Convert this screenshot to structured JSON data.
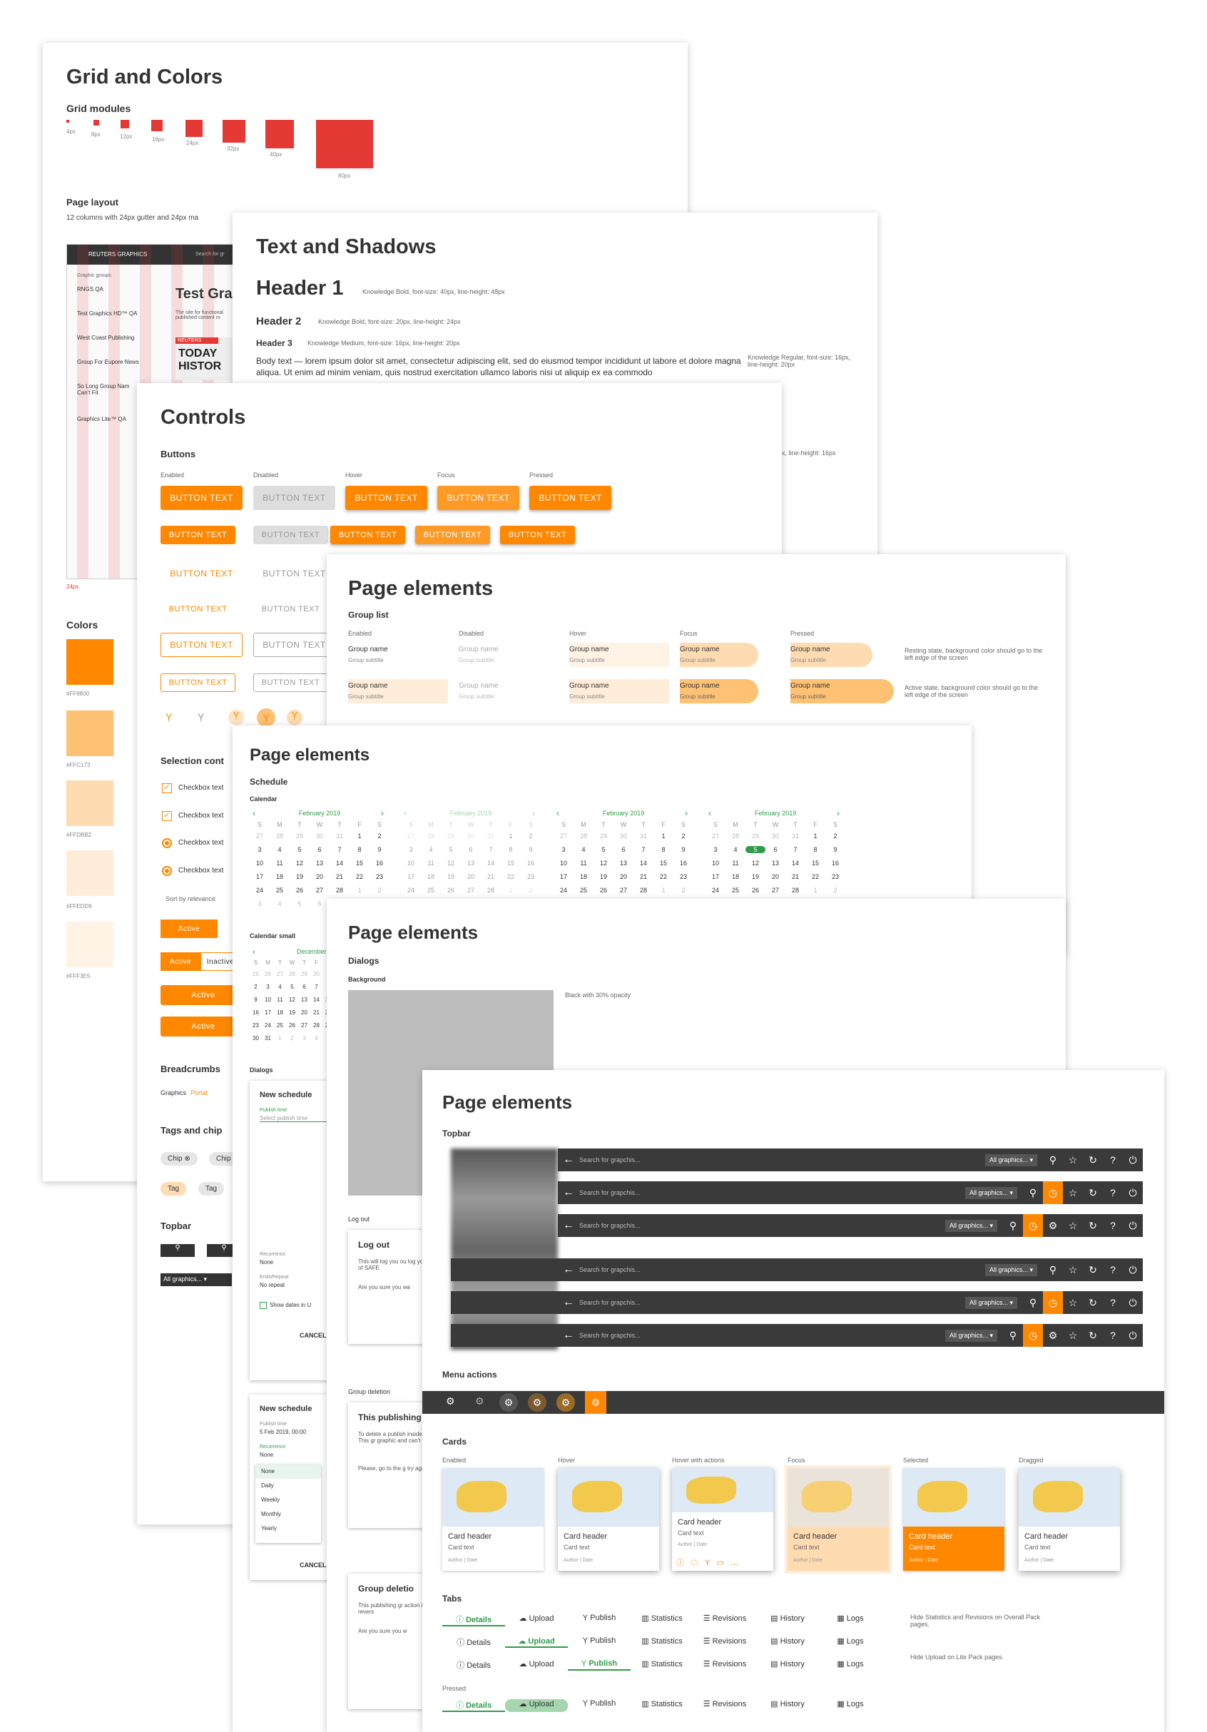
{
  "grid": {
    "title": "Grid and Colors",
    "modules_title": "Grid modules",
    "modules": [
      "4px",
      "8px",
      "12px",
      "16px",
      "24px",
      "32px",
      "40px",
      "80px"
    ],
    "layout_title": "Page layout",
    "layout_desc": "12 columns with 24px gutter and 24px ma",
    "gutter": "24px",
    "colors_title": "Colors",
    "colors": [
      {
        "hex": "#FF8800",
        "label": "#FF8800"
      },
      {
        "hex": "#FFC173",
        "label": "#FFC173"
      },
      {
        "hex": "#FFDBB2",
        "label": "#FFDBB2"
      },
      {
        "hex": "#FFEDD9",
        "label": "#FFEDD9"
      },
      {
        "hex": "#FFF3E5",
        "label": "#FFF3E5"
      }
    ],
    "preview": {
      "brand": "REUTERS GRAPHICS",
      "search": "Search for gr",
      "side_title": "Graphic groups",
      "crumb": "Graphics Portal",
      "heading": "Test Gra",
      "desc": "The site for functional published content m",
      "groups": [
        {
          "name": "RNGS QA",
          "sub": "Group subtitle"
        },
        {
          "name": "Test Graphics HD™ QA",
          "sub": "Group subtitle"
        },
        {
          "name": "West Coast Publishing",
          "sub": "Group subtitle"
        },
        {
          "name": "Group For Eupore News",
          "sub": "Group subtitle"
        },
        {
          "name": "So Long Group Nam Can't Fit",
          "sub": "Group subtitle"
        },
        {
          "name": "Graphics Lite™ QA",
          "sub": "Group subtitle"
        }
      ],
      "news1": "TODAY",
      "news2": "HISTOR",
      "news_brand": "REUTERS"
    }
  },
  "text": {
    "title": "Text and Shadows",
    "h1": "Header 1",
    "h1_note": "Knowledge Bold, font-size: 40px, line-height: 48px",
    "h2": "Header 2",
    "h2_note": "Knowledge Bold, font-size: 20px, line-height: 24px",
    "h3": "Header 3",
    "h3_note": "Knowledge Medium, font-size: 16px, line-height: 20px",
    "body": "Body text — lorem ipsum dolor sit amet, consectetur adipiscing elit, sed do eiusmod tempor incididunt ut labore et dolore magna aliqua. Ut enim ad minim veniam, quis nostrud exercitation ullamco laboris nisi ut aliquip ex ea commodo",
    "body_note": "Knowledge Regular, font-size: 16px, line-height: 20px",
    "note2": "px, line-height: 16px"
  },
  "controls": {
    "title": "Controls",
    "buttons_title": "Buttons",
    "states": [
      "Enabled",
      "Disabled",
      "Hover",
      "Focus",
      "Pressed"
    ],
    "btn": "BUTTON TEXT",
    "selection_title": "Selection cont",
    "checkbox": "Checkbox text",
    "sort": "Sort by relevance",
    "active": "Active",
    "inactive": "Inactive",
    "breadcrumbs_title": "Breadcrumbs",
    "crumb_a": "Graphics",
    "crumb_b": "Portal",
    "tags_title": "Tags and chip",
    "chip": "Chip",
    "tag": "Tag",
    "topbar_title": "Topbar",
    "all_graphics": "All graphics..."
  },
  "group_list": {
    "title": "Page elements",
    "sub": "Group list",
    "states": [
      "Enabled",
      "Disabled",
      "Hover",
      "Focus",
      "Pressed"
    ],
    "name": "Group name",
    "subtitle": "Group subtitle",
    "note1": "Resting state, background color should go to the left edge of the screen",
    "note2": "Active state, background color should go to the left edge of the screen"
  },
  "schedule": {
    "title": "Page elements",
    "sub": "Schedule",
    "calendar": "Calendar",
    "month": "February 2019",
    "days": [
      "S",
      "M",
      "T",
      "W",
      "T",
      "F",
      "S"
    ],
    "weeks": [
      [
        "27",
        "28",
        "29",
        "30",
        "31",
        "1",
        "2"
      ],
      [
        "3",
        "4",
        "5",
        "6",
        "7",
        "8",
        "9"
      ],
      [
        "10",
        "11",
        "12",
        "13",
        "14",
        "15",
        "16"
      ],
      [
        "17",
        "18",
        "19",
        "20",
        "21",
        "22",
        "23"
      ],
      [
        "24",
        "25",
        "26",
        "27",
        "28",
        "1",
        "2"
      ],
      [
        "3",
        "4",
        "5",
        "6",
        "7",
        "8",
        "9"
      ]
    ],
    "small": "Calendar small",
    "small_month": "December 2018",
    "small_weeks": [
      [
        "25",
        "26",
        "27",
        "28",
        "29",
        "30",
        "1"
      ],
      [
        "2",
        "3",
        "4",
        "5",
        "6",
        "7",
        "8"
      ],
      [
        "9",
        "10",
        "11",
        "12",
        "13",
        "14",
        "15"
      ],
      [
        "16",
        "17",
        "18",
        "19",
        "20",
        "21",
        "22"
      ],
      [
        "23",
        "24",
        "25",
        "26",
        "27",
        "28",
        "29"
      ],
      [
        "30",
        "31",
        "1",
        "2",
        "3",
        "4",
        "5"
      ]
    ],
    "dialogs": "Dialogs",
    "new_schedule": "New schedule",
    "publish_time": "Publish time",
    "select_time": "Select publish time",
    "recurrence": "Recurrence",
    "none": "None",
    "repeat": "Ends/Repeat",
    "no_repeat": "No repeat",
    "show_dates": "Show dates in U",
    "cancel": "CANCEL",
    "date": "5 Feb 2019, 00:00",
    "options": [
      "None",
      "Daily",
      "Weekly",
      "Monthly",
      "Yearly"
    ]
  },
  "dialogs": {
    "title": "Page elements",
    "sub": "Dialogs",
    "bg": "Background",
    "bg_note": "Black with 30% opacity",
    "logout": "Log out",
    "logout_title": "Log out",
    "logout_body": "This will log you ou log you out of SAFE",
    "logout_q": "Are you sure you wa",
    "group_del": "Group deletion",
    "pub_title": "This publishing",
    "pub_body": "To delete a publish inside first. This gr graphic and can't t",
    "pub_body2": "Please, go to the g try again.",
    "gd_title": "Group deletio",
    "gd_body": "This publishing gr action is not revers",
    "gd_q": "Are you sure you w"
  },
  "elements": {
    "title": "Page elements",
    "topbar": "Topbar",
    "search": "Search for grapchis...",
    "all": "All graphics...",
    "menu_actions": "Menu actions",
    "cards": "Cards",
    "card_states": [
      "Enabled",
      "Hover",
      "Hover with actions",
      "Focus",
      "Selected",
      "Dragged"
    ],
    "card_header": "Card header",
    "card_text": "Card text",
    "card_meta": "Author | Date",
    "tabs_title": "Tabs",
    "tabs": [
      "Details",
      "Upload",
      "Publish",
      "Statistics",
      "Revisions",
      "History",
      "Logs"
    ],
    "tabs_note1": "Hide Statistics and Revisions on Overall Pack pages.",
    "tabs_note2": "Hide Upload on Lite Pack pages.",
    "pressed": "Pressed"
  }
}
